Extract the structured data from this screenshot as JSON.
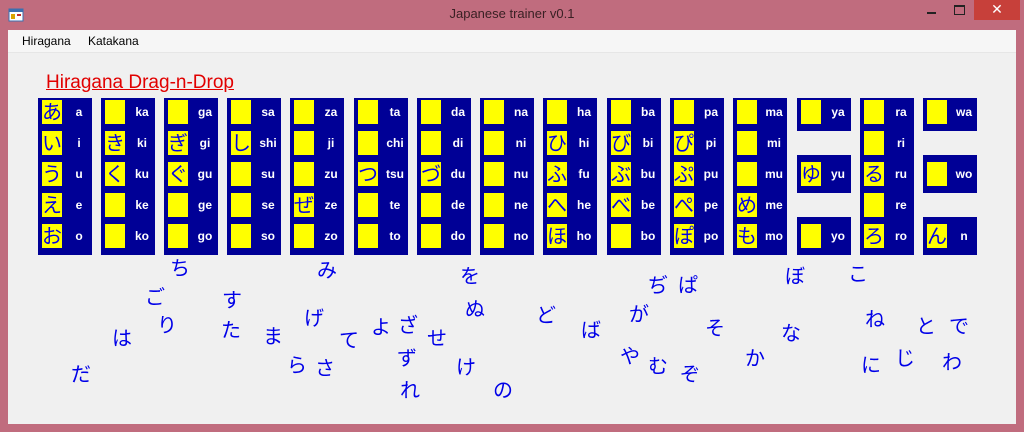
{
  "window": {
    "title": "Japanese trainer v0.1",
    "close_glyph": "✕"
  },
  "menu": [
    "Hiragana",
    "Katakana"
  ],
  "heading": "Hiragana Drag-n-Drop",
  "columns": [
    [
      {
        "r": "a",
        "k": "あ"
      },
      {
        "r": "i",
        "k": "い"
      },
      {
        "r": "u",
        "k": "う"
      },
      {
        "r": "e",
        "k": "え"
      },
      {
        "r": "o",
        "k": "お"
      }
    ],
    [
      {
        "r": "ka",
        "k": ""
      },
      {
        "r": "ki",
        "k": "き"
      },
      {
        "r": "ku",
        "k": "く"
      },
      {
        "r": "ke",
        "k": ""
      },
      {
        "r": "ko",
        "k": ""
      }
    ],
    [
      {
        "r": "ga",
        "k": ""
      },
      {
        "r": "gi",
        "k": "ぎ"
      },
      {
        "r": "gu",
        "k": "ぐ"
      },
      {
        "r": "ge",
        "k": ""
      },
      {
        "r": "go",
        "k": ""
      }
    ],
    [
      {
        "r": "sa",
        "k": ""
      },
      {
        "r": "shi",
        "k": "し"
      },
      {
        "r": "su",
        "k": ""
      },
      {
        "r": "se",
        "k": ""
      },
      {
        "r": "so",
        "k": ""
      }
    ],
    [
      {
        "r": "za",
        "k": ""
      },
      {
        "r": "ji",
        "k": ""
      },
      {
        "r": "zu",
        "k": ""
      },
      {
        "r": "ze",
        "k": "ぜ"
      },
      {
        "r": "zo",
        "k": ""
      }
    ],
    [
      {
        "r": "ta",
        "k": ""
      },
      {
        "r": "chi",
        "k": ""
      },
      {
        "r": "tsu",
        "k": "つ"
      },
      {
        "r": "te",
        "k": ""
      },
      {
        "r": "to",
        "k": ""
      }
    ],
    [
      {
        "r": "da",
        "k": ""
      },
      {
        "r": "di",
        "k": ""
      },
      {
        "r": "du",
        "k": "づ"
      },
      {
        "r": "de",
        "k": ""
      },
      {
        "r": "do",
        "k": ""
      }
    ],
    [
      {
        "r": "na",
        "k": ""
      },
      {
        "r": "ni",
        "k": ""
      },
      {
        "r": "nu",
        "k": ""
      },
      {
        "r": "ne",
        "k": ""
      },
      {
        "r": "no",
        "k": ""
      }
    ],
    [
      {
        "r": "ha",
        "k": ""
      },
      {
        "r": "hi",
        "k": "ひ"
      },
      {
        "r": "fu",
        "k": "ふ"
      },
      {
        "r": "he",
        "k": "へ"
      },
      {
        "r": "ho",
        "k": "ほ"
      }
    ],
    [
      {
        "r": "ba",
        "k": ""
      },
      {
        "r": "bi",
        "k": "び"
      },
      {
        "r": "bu",
        "k": "ぶ"
      },
      {
        "r": "be",
        "k": "べ"
      },
      {
        "r": "bo",
        "k": ""
      }
    ],
    [
      {
        "r": "pa",
        "k": ""
      },
      {
        "r": "pi",
        "k": "ぴ"
      },
      {
        "r": "pu",
        "k": "ぷ"
      },
      {
        "r": "pe",
        "k": "ぺ"
      },
      {
        "r": "po",
        "k": "ぽ"
      }
    ],
    [
      {
        "r": "ma",
        "k": ""
      },
      {
        "r": "mi",
        "k": ""
      },
      {
        "r": "mu",
        "k": ""
      },
      {
        "r": "me",
        "k": "め"
      },
      {
        "r": "mo",
        "k": "も"
      }
    ],
    [
      {
        "r": "ya",
        "k": ""
      },
      null,
      {
        "r": "yu",
        "k": "ゆ"
      },
      null,
      {
        "r": "yo",
        "k": ""
      }
    ],
    [
      {
        "r": "ra",
        "k": ""
      },
      {
        "r": "ri",
        "k": ""
      },
      {
        "r": "ru",
        "k": "る"
      },
      {
        "r": "re",
        "k": ""
      },
      {
        "r": "ro",
        "k": "ろ"
      }
    ],
    [
      {
        "r": "wa",
        "k": ""
      },
      null,
      {
        "r": "wo",
        "k": ""
      },
      null,
      {
        "r": "n",
        "k": "ん"
      }
    ]
  ],
  "loose_kana": [
    "ち",
    "み",
    "を",
    "ぢ",
    "ぱ",
    "ぼ",
    "こ",
    "ご",
    "す",
    "り",
    "げ",
    "よ",
    "ざ",
    "せ",
    "ぬ",
    "ど",
    "が",
    "ね",
    "と",
    "で",
    "は",
    "た",
    "ま",
    "て",
    "ば",
    "そ",
    "な",
    "ら",
    "さ",
    "ず",
    "け",
    "や",
    "む",
    "か",
    "に",
    "じ",
    "わ",
    "だ",
    "ぞ",
    "れ",
    "の"
  ],
  "colors": {
    "board": "#000096",
    "slot": "#ffff00",
    "kana": "#0000e8",
    "heading": "#e10000",
    "frame": "#c06c7e"
  }
}
